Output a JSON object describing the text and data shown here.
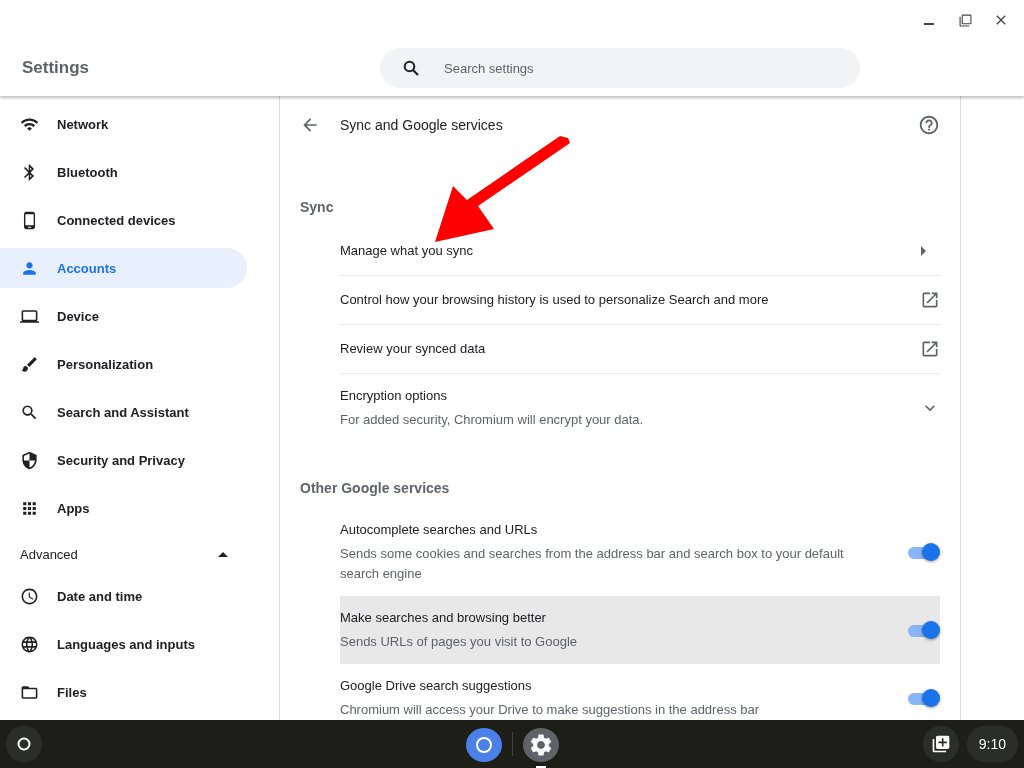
{
  "window": {
    "title": "Settings"
  },
  "search": {
    "placeholder": "Search settings"
  },
  "sidebar": {
    "items": [
      {
        "label": "Network",
        "selected": false
      },
      {
        "label": "Bluetooth",
        "selected": false
      },
      {
        "label": "Connected devices",
        "selected": false
      },
      {
        "label": "Accounts",
        "selected": true
      },
      {
        "label": "Device",
        "selected": false
      },
      {
        "label": "Personalization",
        "selected": false
      },
      {
        "label": "Search and Assistant",
        "selected": false
      },
      {
        "label": "Security and Privacy",
        "selected": false
      },
      {
        "label": "Apps",
        "selected": false
      }
    ],
    "advanced": {
      "label": "Advanced",
      "expanded": true,
      "items": [
        {
          "label": "Date and time",
          "selected": false
        },
        {
          "label": "Languages and inputs",
          "selected": false
        },
        {
          "label": "Files",
          "selected": false
        }
      ]
    }
  },
  "page": {
    "title": "Sync and Google services",
    "sections": [
      {
        "title": "Sync",
        "rows": [
          {
            "kind": "submenu",
            "label": "Manage what you sync"
          },
          {
            "kind": "external",
            "label": "Control how your browsing history is used to personalize Search and more"
          },
          {
            "kind": "external",
            "label": "Review your synced data"
          },
          {
            "kind": "expand",
            "label": "Encryption options",
            "sublabel": "For added security, Chromium will encrypt your data."
          }
        ]
      },
      {
        "title": "Other Google services",
        "rows": [
          {
            "kind": "toggle",
            "label": "Autocomplete searches and URLs",
            "sublabel": "Sends some cookies and searches from the address bar and search box to your default search engine",
            "on": true,
            "hovered": false
          },
          {
            "kind": "toggle",
            "label": "Make searches and browsing better",
            "sublabel": "Sends URLs of pages you visit to Google",
            "on": true,
            "hovered": true
          },
          {
            "kind": "toggle",
            "label": "Google Drive search suggestions",
            "sublabel": "Chromium will access your Drive to make suggestions in the address bar",
            "on": true,
            "hovered": false
          }
        ]
      }
    ]
  },
  "shelf": {
    "apps": [
      {
        "kind": "browser",
        "active": false
      },
      {
        "kind": "settings",
        "active": true
      }
    ],
    "time": "9:10"
  }
}
